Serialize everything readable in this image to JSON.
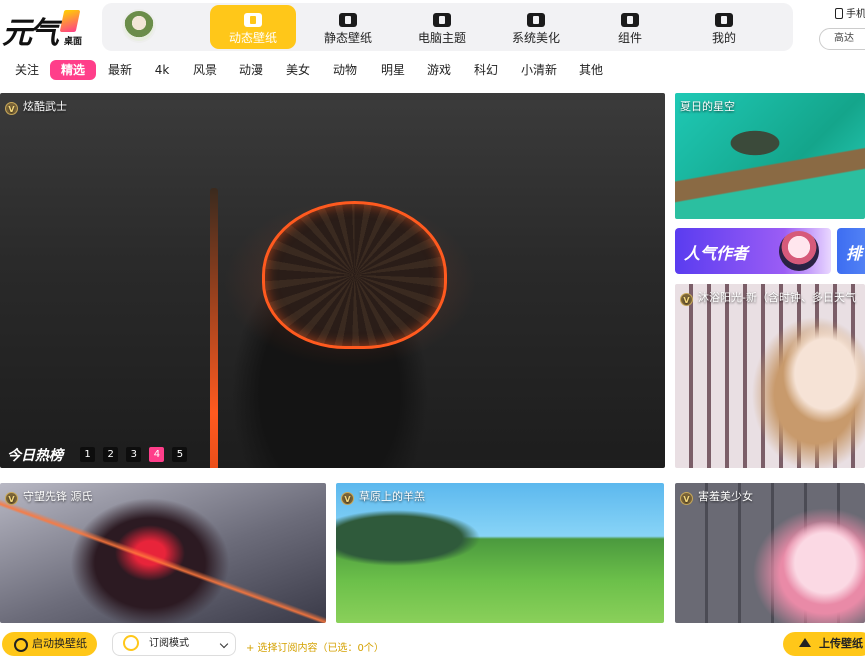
{
  "logo": {
    "main": "元气",
    "sub": "桌面"
  },
  "nav": {
    "items": [
      {
        "label": "动态壁纸",
        "icon": "play-icon"
      },
      {
        "label": "静态壁纸",
        "icon": "image-icon"
      },
      {
        "label": "电脑主题",
        "icon": "shirt-icon"
      },
      {
        "label": "系统美化",
        "icon": "flower-icon"
      },
      {
        "label": "组件",
        "icon": "widget-icon"
      },
      {
        "label": "我的",
        "icon": "profile-icon"
      }
    ],
    "active_index": 0
  },
  "header_right": {
    "phone_label": "手机",
    "btn_label": "高达"
  },
  "tabs": [
    "关注",
    "精选",
    "最新",
    "4k",
    "风景",
    "动漫",
    "美女",
    "动物",
    "明星",
    "游戏",
    "科幻",
    "小清新",
    "其他"
  ],
  "active_tab": 1,
  "hero": {
    "title": "炫酷武士",
    "hot_label": "今日热榜",
    "pages": [
      "1",
      "2",
      "3",
      "4",
      "5"
    ],
    "current_page": 4
  },
  "cards": {
    "star": "夏日的星空",
    "girl": "沐浴阳光-新（含时钟、多日天气",
    "mech": "守望先锋 源氏",
    "field": "草原上的羊羔",
    "pink": "害羞美少女"
  },
  "banners": {
    "authors": "人气作者",
    "rank": "排"
  },
  "badge_letter": "V",
  "bottom": {
    "auto_btn": "启动换壁纸",
    "mode": "订阅模式",
    "subscribe_tip": "+ 选择订阅内容（已选：0个）",
    "upload_btn": "上传壁纸"
  },
  "colors": {
    "accent_yellow": "#ffc719",
    "accent_pink": "#ff3e8a"
  }
}
